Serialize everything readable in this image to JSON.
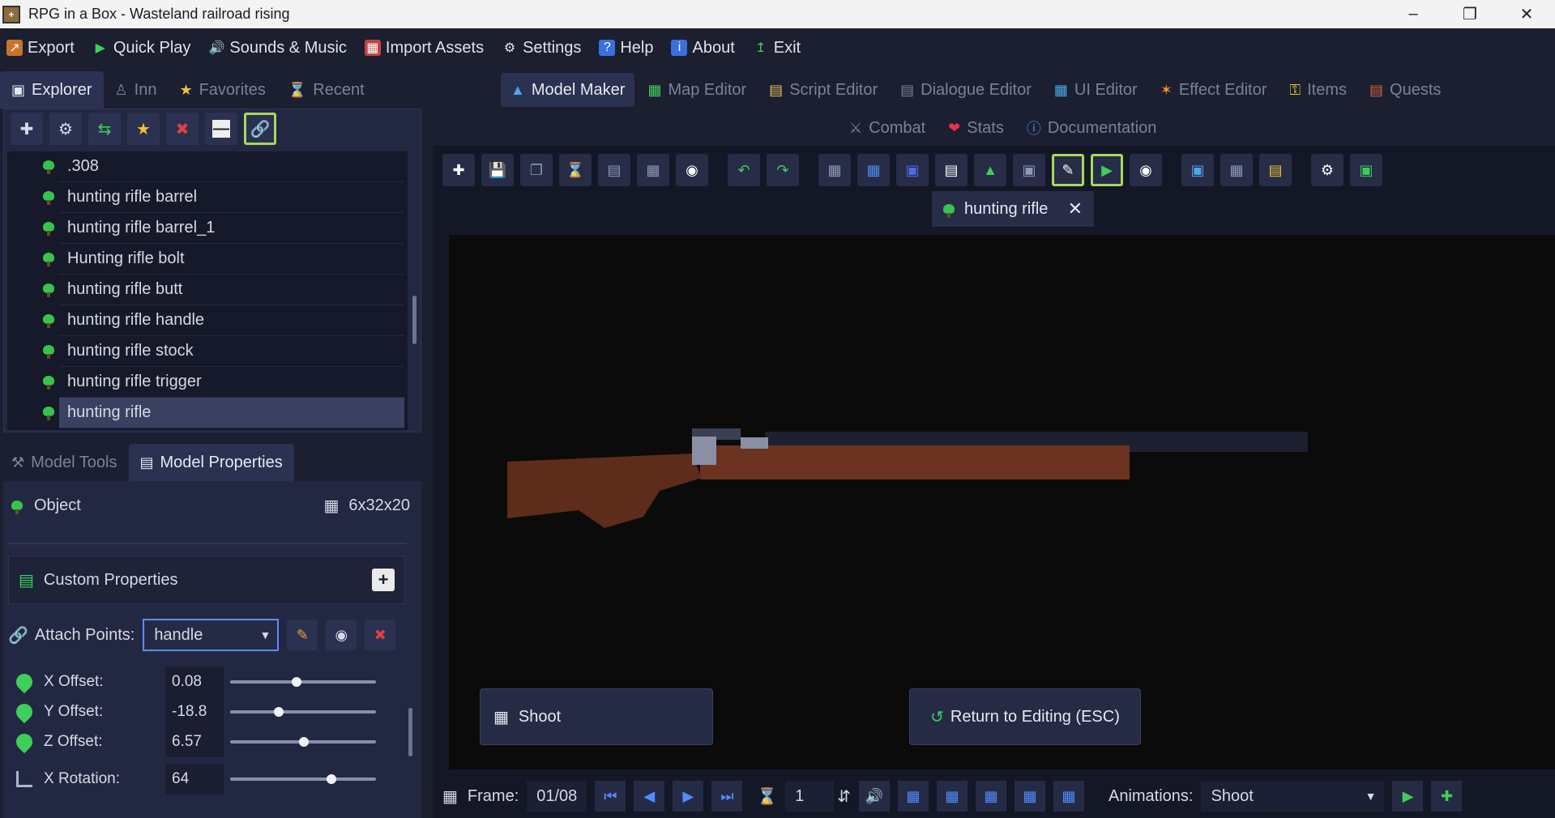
{
  "window": {
    "title": "RPG in a Box - Wasteland railroad rising"
  },
  "menu": [
    "Export",
    "Quick Play",
    "Sounds & Music",
    "Import Assets",
    "Settings",
    "Help",
    "About",
    "Exit"
  ],
  "left_tabs": [
    "Explorer",
    "Inn",
    "Favorites",
    "Recent"
  ],
  "tree_items": [
    ".308",
    "hunting rifle barrel",
    "hunting rifle barrel_1",
    "Hunting rifle bolt",
    "hunting rifle butt",
    "hunting rifle handle",
    "hunting rifle stock",
    "hunting rifle trigger",
    "hunting rifle"
  ],
  "props_tabs": [
    "Model Tools",
    "Model Properties"
  ],
  "object": {
    "label": "Object",
    "dimensions": "6x32x20"
  },
  "custom_properties": "Custom Properties",
  "attach": {
    "label": "Attach Points:",
    "value": "handle"
  },
  "fields": [
    {
      "label": "X Offset:",
      "value": "0.08",
      "slider": 0.42
    },
    {
      "label": "Y Offset:",
      "value": "-18.8",
      "slider": 0.3
    },
    {
      "label": "Z Offset:",
      "value": "6.57",
      "slider": 0.47
    },
    {
      "label": "X Rotation:",
      "value": "64",
      "slider": 0.66
    }
  ],
  "editor_tabs": [
    "Model Maker",
    "Map Editor",
    "Script Editor",
    "Dialogue Editor",
    "UI Editor",
    "Effect Editor",
    "Items",
    "Quests"
  ],
  "editor_tabs2": [
    "Combat",
    "Stats",
    "Documentation"
  ],
  "model_tab": "hunting rifle",
  "viewport": {
    "shoot": "Shoot",
    "return": "Return to Editing (ESC)"
  },
  "bottom": {
    "frame_label": "Frame:",
    "frame_value": "01/08",
    "speed_value": "1",
    "animations_label": "Animations:",
    "animation_value": "Shoot"
  },
  "colors": {
    "accent_green": "#a7d85a",
    "leaf_green": "#37c44a",
    "panel": "#232842",
    "bg": "#1b1f30",
    "rifle_wood": "#6b3320"
  }
}
